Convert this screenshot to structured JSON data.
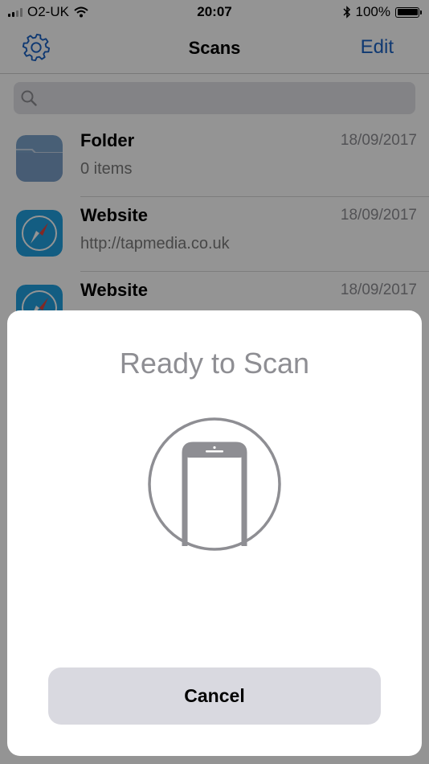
{
  "status_bar": {
    "carrier": "O2-UK",
    "time": "20:07",
    "battery_percent": "100%",
    "battery_level": 1.0
  },
  "nav": {
    "title": "Scans",
    "edit_label": "Edit",
    "settings_icon": "gear-icon"
  },
  "search": {
    "placeholder": "",
    "icon": "search-icon"
  },
  "list": {
    "items": [
      {
        "title": "Folder",
        "subtitle": "0 items",
        "date": "18/09/2017",
        "icon": "folder-icon"
      },
      {
        "title": "Website",
        "subtitle": "http://tapmedia.co.uk",
        "date": "18/09/2017",
        "icon": "compass-icon"
      },
      {
        "title": "Website",
        "subtitle": "",
        "date": "18/09/2017",
        "icon": "compass-icon"
      }
    ]
  },
  "sheet": {
    "title": "Ready to Scan",
    "illustration_icon": "phone-icon",
    "cancel_label": "Cancel"
  },
  "colors": {
    "accent": "#1b62c4",
    "folder": "#7da4cc",
    "compass": "#22a0e0",
    "gray_text": "#8e8e93",
    "button_bg": "#d9d9e0"
  }
}
